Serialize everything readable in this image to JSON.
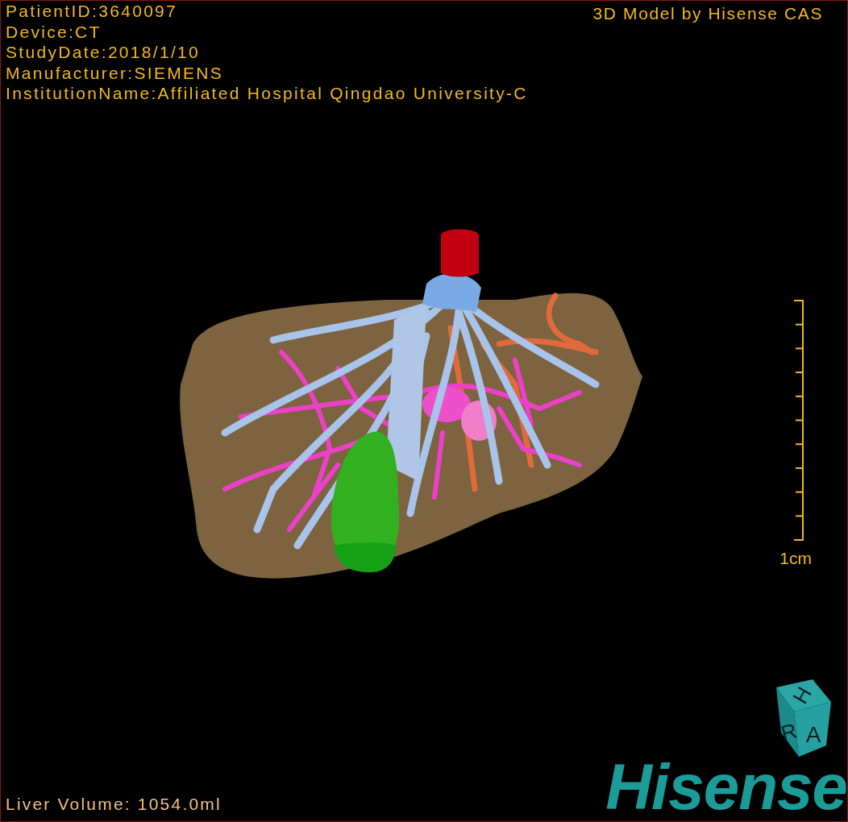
{
  "header": {
    "info_lines": [
      "PatientID:3640097",
      "Device:CT",
      "StudyDate:2018/1/10",
      "Manufacturer:SIEMENS",
      "InstitutionName:Affiliated Hospital Qingdao University-C"
    ],
    "model_credit": "3D Model by Hisense CAS"
  },
  "scale_bar": {
    "label": "1cm"
  },
  "orientation_cube": {
    "faces": [
      "H",
      "R",
      "A"
    ]
  },
  "footer": {
    "liver_volume": "Liver Volume: 1054.0ml",
    "logo": "Hisense"
  }
}
